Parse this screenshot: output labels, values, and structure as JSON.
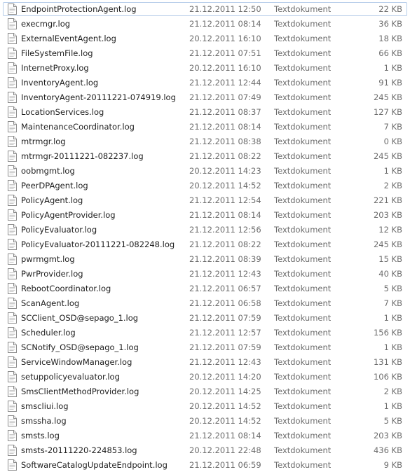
{
  "files": [
    {
      "name": "EndpointProtectionAgent.log",
      "date": "21.12.2011 12:50",
      "type": "Textdokument",
      "size": "22 KB"
    },
    {
      "name": "execmgr.log",
      "date": "21.12.2011 08:14",
      "type": "Textdokument",
      "size": "36 KB"
    },
    {
      "name": "ExternalEventAgent.log",
      "date": "20.12.2011 16:10",
      "type": "Textdokument",
      "size": "18 KB"
    },
    {
      "name": "FileSystemFile.log",
      "date": "21.12.2011 07:51",
      "type": "Textdokument",
      "size": "66 KB"
    },
    {
      "name": "InternetProxy.log",
      "date": "20.12.2011 16:10",
      "type": "Textdokument",
      "size": "1 KB"
    },
    {
      "name": "InventoryAgent.log",
      "date": "21.12.2011 12:44",
      "type": "Textdokument",
      "size": "91 KB"
    },
    {
      "name": "InventoryAgent-20111221-074919.log",
      "date": "21.12.2011 07:49",
      "type": "Textdokument",
      "size": "245 KB"
    },
    {
      "name": "LocationServices.log",
      "date": "21.12.2011 08:37",
      "type": "Textdokument",
      "size": "127 KB"
    },
    {
      "name": "MaintenanceCoordinator.log",
      "date": "21.12.2011 08:14",
      "type": "Textdokument",
      "size": "7 KB"
    },
    {
      "name": "mtrmgr.log",
      "date": "21.12.2011 08:38",
      "type": "Textdokument",
      "size": "0 KB"
    },
    {
      "name": "mtrmgr-20111221-082237.log",
      "date": "21.12.2011 08:22",
      "type": "Textdokument",
      "size": "245 KB"
    },
    {
      "name": "oobmgmt.log",
      "date": "20.12.2011 14:23",
      "type": "Textdokument",
      "size": "1 KB"
    },
    {
      "name": "PeerDPAgent.log",
      "date": "20.12.2011 14:52",
      "type": "Textdokument",
      "size": "2 KB"
    },
    {
      "name": "PolicyAgent.log",
      "date": "21.12.2011 12:54",
      "type": "Textdokument",
      "size": "221 KB"
    },
    {
      "name": "PolicyAgentProvider.log",
      "date": "21.12.2011 08:14",
      "type": "Textdokument",
      "size": "203 KB"
    },
    {
      "name": "PolicyEvaluator.log",
      "date": "21.12.2011 12:56",
      "type": "Textdokument",
      "size": "12 KB"
    },
    {
      "name": "PolicyEvaluator-20111221-082248.log",
      "date": "21.12.2011 08:22",
      "type": "Textdokument",
      "size": "245 KB"
    },
    {
      "name": "pwrmgmt.log",
      "date": "21.12.2011 08:39",
      "type": "Textdokument",
      "size": "15 KB"
    },
    {
      "name": "PwrProvider.log",
      "date": "21.12.2011 12:43",
      "type": "Textdokument",
      "size": "40 KB"
    },
    {
      "name": "RebootCoordinator.log",
      "date": "21.12.2011 06:57",
      "type": "Textdokument",
      "size": "5 KB"
    },
    {
      "name": "ScanAgent.log",
      "date": "21.12.2011 06:58",
      "type": "Textdokument",
      "size": "7 KB"
    },
    {
      "name": "SCClient_OSD@sepago_1.log",
      "date": "21.12.2011 07:59",
      "type": "Textdokument",
      "size": "1 KB"
    },
    {
      "name": "Scheduler.log",
      "date": "21.12.2011 12:57",
      "type": "Textdokument",
      "size": "156 KB"
    },
    {
      "name": "SCNotify_OSD@sepago_1.log",
      "date": "21.12.2011 07:59",
      "type": "Textdokument",
      "size": "1 KB"
    },
    {
      "name": "ServiceWindowManager.log",
      "date": "21.12.2011 12:43",
      "type": "Textdokument",
      "size": "131 KB"
    },
    {
      "name": "setuppolicyevaluator.log",
      "date": "20.12.2011 14:20",
      "type": "Textdokument",
      "size": "106 KB"
    },
    {
      "name": "SmsClientMethodProvider.log",
      "date": "20.12.2011 14:25",
      "type": "Textdokument",
      "size": "2 KB"
    },
    {
      "name": "smscliui.log",
      "date": "20.12.2011 14:52",
      "type": "Textdokument",
      "size": "1 KB"
    },
    {
      "name": "smssha.log",
      "date": "20.12.2011 14:52",
      "type": "Textdokument",
      "size": "5 KB"
    },
    {
      "name": "smsts.log",
      "date": "21.12.2011 08:14",
      "type": "Textdokument",
      "size": "203 KB"
    },
    {
      "name": "smsts-20111220-224853.log",
      "date": "20.12.2011 22:48",
      "type": "Textdokument",
      "size": "436 KB"
    },
    {
      "name": "SoftwareCatalogUpdateEndpoint.log",
      "date": "21.12.2011 06:59",
      "type": "Textdokument",
      "size": "9 KB"
    }
  ],
  "icon": "text-document-icon",
  "colors": {
    "focus_border": "#b6cde9",
    "name_text": "#1e1e1e",
    "detail_text": "#6d6d6d"
  }
}
